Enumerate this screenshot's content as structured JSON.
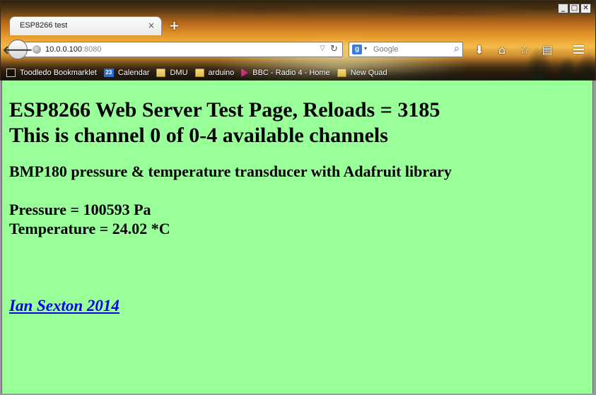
{
  "window": {
    "controls": {
      "minimize": "_",
      "maximize": "□",
      "close": "✕"
    }
  },
  "tab": {
    "title": "ESP8266 test",
    "close": "×"
  },
  "newtab": "+",
  "url": {
    "host": "10.0.0.100",
    "port": ":8080"
  },
  "search": {
    "placeholder": "Google",
    "engine_icon": "g"
  },
  "toolbar_icons": [
    "download-icon",
    "home-icon",
    "bookmark-star-icon",
    "reader-icon"
  ],
  "bookmarks": [
    {
      "label": "Toodledo Bookmarklet",
      "icon": "page"
    },
    {
      "label": "Calendar",
      "icon": "calendar",
      "badge": "23"
    },
    {
      "label": "DMU",
      "icon": "folder"
    },
    {
      "label": "arduino",
      "icon": "folder"
    },
    {
      "label": "BBC - Radio 4 - Home",
      "icon": "bbc"
    },
    {
      "label": "New Quad",
      "icon": "folder"
    }
  ],
  "page": {
    "heading_line1": "ESP8266 Web Server Test Page, Reloads = 3185",
    "heading_line2": "This is channel 0 of 0-4 available channels",
    "subheading": "BMP180 pressure & temperature transducer with Adafruit library",
    "pressure": "Pressure = 100593 Pa",
    "temperature": "Temperature = 24.02 *C",
    "author_link": "Ian Sexton 2014"
  },
  "colors": {
    "page_background": "#99ff99",
    "link": "#0000ee"
  }
}
